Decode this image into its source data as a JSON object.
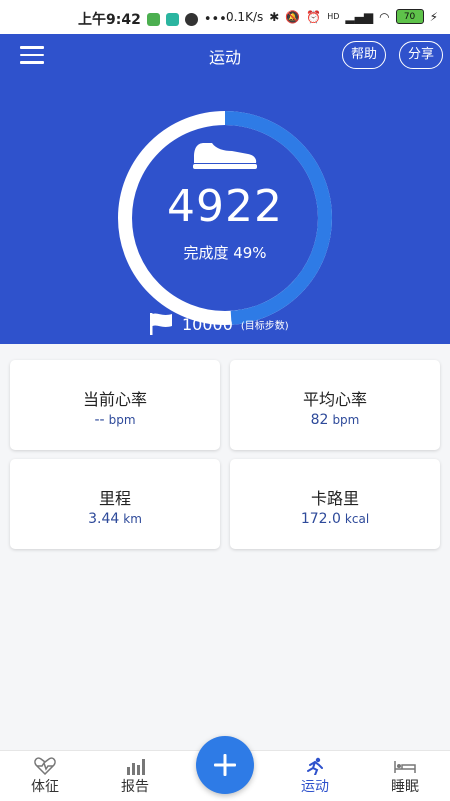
{
  "status_bar": {
    "time": "上午9:42",
    "network_speed": "0.1K/s",
    "network_type": "HD",
    "battery": "70"
  },
  "header": {
    "title": "运动",
    "help_label": "帮助",
    "share_label": "分享"
  },
  "progress": {
    "steps": "4922",
    "completion_text": "完成度 49%",
    "completion_fraction": 0.49,
    "goal_value": "10000",
    "goal_label": "(目标步数)"
  },
  "stats": [
    {
      "label": "当前心率",
      "value": "--",
      "unit": "bpm"
    },
    {
      "label": "平均心率",
      "value": "82",
      "unit": "bpm"
    },
    {
      "label": "里程",
      "value": "3.44",
      "unit": "km"
    },
    {
      "label": "卡路里",
      "value": "172.0",
      "unit": "kcal"
    }
  ],
  "nav": {
    "items": [
      {
        "label": "体征",
        "icon": "heart-pulse-icon"
      },
      {
        "label": "报告",
        "icon": "bar-chart-icon"
      },
      {
        "label": "运动",
        "icon": "runner-icon"
      },
      {
        "label": "睡眠",
        "icon": "bed-icon"
      }
    ],
    "active": "运动",
    "fab_icon": "plus-icon"
  },
  "colors": {
    "header_bg": "#2f52cc",
    "ring_fill": "#2e7be6",
    "ring_track": "#ffffff",
    "accent": "#2f52cc",
    "stat_value": "#2e4a9a"
  }
}
